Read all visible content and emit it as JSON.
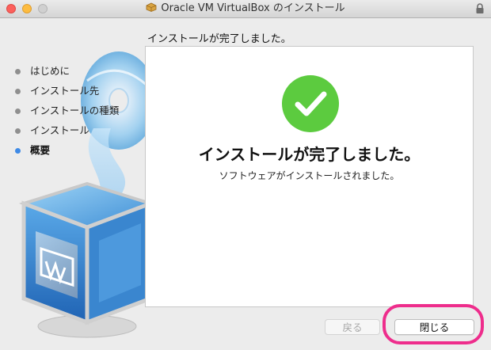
{
  "window": {
    "title": "Oracle VM VirtualBox のインストール"
  },
  "sidebar": {
    "steps": [
      {
        "label": "はじめに",
        "state": "done"
      },
      {
        "label": "インストール先",
        "state": "done"
      },
      {
        "label": "インストールの種類",
        "state": "done"
      },
      {
        "label": "インストール",
        "state": "done"
      },
      {
        "label": "概要",
        "state": "active"
      }
    ]
  },
  "header": {
    "text": "インストールが完了しました。"
  },
  "main": {
    "title": "インストールが完了しました。",
    "subtitle": "ソフトウェアがインストールされました。"
  },
  "buttons": {
    "back_label": "戻る",
    "close_label": "閉じる"
  },
  "colors": {
    "success_green": "#5ccb3f",
    "active_step_dot": "#3e8ae6",
    "inactive_step_dot": "#8f8f8f",
    "highlight_ring": "#ee2d8c"
  }
}
